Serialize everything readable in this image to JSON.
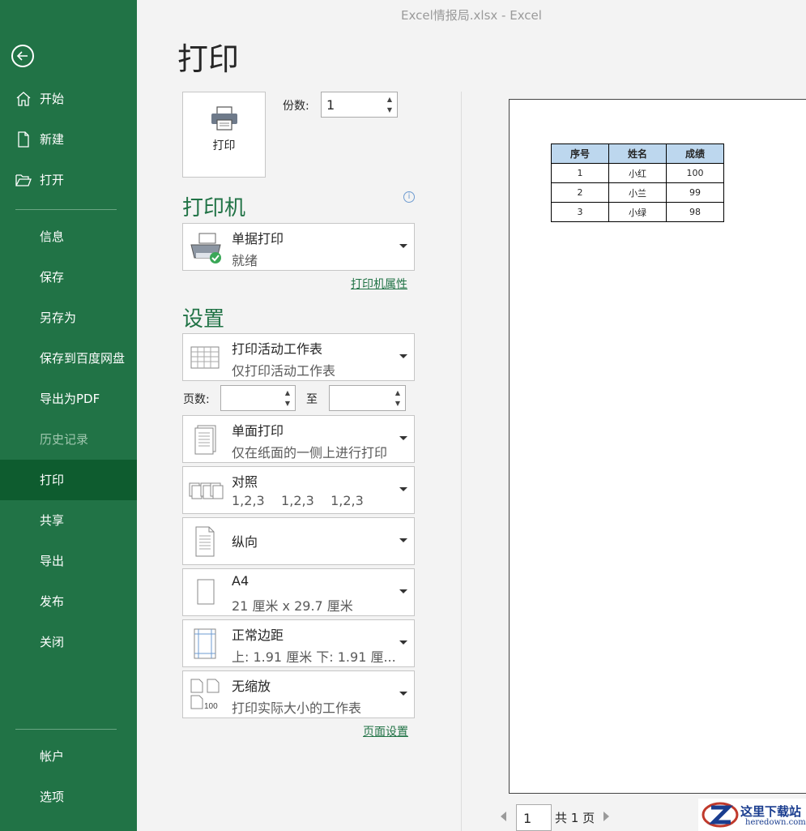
{
  "window": {
    "title": "Excel情报局.xlsx  -  Excel"
  },
  "sidebar": {
    "items": [
      {
        "label": "开始"
      },
      {
        "label": "新建"
      },
      {
        "label": "打开"
      },
      {
        "label": "信息"
      },
      {
        "label": "保存"
      },
      {
        "label": "另存为"
      },
      {
        "label": "保存到百度网盘"
      },
      {
        "label": "导出为PDF"
      },
      {
        "label": "历史记录"
      },
      {
        "label": "打印"
      },
      {
        "label": "共享"
      },
      {
        "label": "导出"
      },
      {
        "label": "发布"
      },
      {
        "label": "关闭"
      },
      {
        "label": "帐户"
      },
      {
        "label": "选项"
      }
    ],
    "active": "打印",
    "disabled": "历史记录",
    "bg_color": "#217346",
    "active_color": "#0e5c2f"
  },
  "page": {
    "title": "打印"
  },
  "print_button": {
    "label": "打印"
  },
  "copies": {
    "label": "份数:",
    "value": "1"
  },
  "printer": {
    "heading": "打印机",
    "name": "单据打印",
    "status": "就绪",
    "properties_link": "打印机属性"
  },
  "settings": {
    "heading": "设置",
    "what": {
      "main": "打印活动工作表",
      "sub": "仅打印活动工作表"
    },
    "pages_label": "页数:",
    "pages_from": "",
    "to_label": "至",
    "pages_to": "",
    "sides": {
      "main": "单面打印",
      "sub": "仅在纸面的一侧上进行打印"
    },
    "collate": {
      "main": "对照",
      "sub": "1,2,3    1,2,3    1,2,3"
    },
    "orientation": {
      "main": "纵向"
    },
    "paper": {
      "main": "A4",
      "sub": "21 厘米 x 29.7 厘米"
    },
    "margins": {
      "main": "正常边距",
      "sub": "上: 1.91 厘米 下: 1.91 厘..."
    },
    "scaling": {
      "main": "无缩放",
      "sub": "打印实际大小的工作表",
      "icon_text": "100"
    },
    "page_setup_link": "页面设置"
  },
  "preview": {
    "table": {
      "headers": [
        "序号",
        "姓名",
        "成绩"
      ],
      "rows": [
        [
          "1",
          "小红",
          "100"
        ],
        [
          "2",
          "小兰",
          "99"
        ],
        [
          "3",
          "小绿",
          "98"
        ]
      ]
    },
    "header_fill": "#bdd7ee"
  },
  "pager": {
    "current": "1",
    "total_text": "共 1 页"
  },
  "watermark": {
    "line1": "这里下载站",
    "line2": "heredown.com"
  }
}
